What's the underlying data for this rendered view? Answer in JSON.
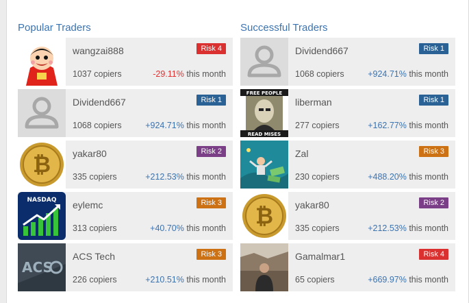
{
  "popular": {
    "title": "Popular Traders",
    "traders": [
      {
        "name": "wangzai888",
        "risk": "Risk 4",
        "copiers": "1037 copiers",
        "gain": "-29.11%",
        "gain_suffix": " this month",
        "avatar": "cartoon-boy-avatar"
      },
      {
        "name": "Dividend667",
        "risk": "Risk 1",
        "copiers": "1068 copiers",
        "gain": "+924.71%",
        "gain_suffix": " this month",
        "avatar": "default-user-avatar"
      },
      {
        "name": "yakar80",
        "risk": "Risk 2",
        "copiers": "335 copiers",
        "gain": "+212.53%",
        "gain_suffix": " this month",
        "avatar": "bitcoin-coin-avatar"
      },
      {
        "name": "eylemc",
        "risk": "Risk 3",
        "copiers": "313 copiers",
        "gain": "+40.70%",
        "gain_suffix": " this month",
        "avatar": "nasdaq-chart-avatar",
        "avatar_text": "NASDAQ"
      },
      {
        "name": "ACS Tech",
        "risk": "Risk 3",
        "copiers": "226 copiers",
        "gain": "+210.51%",
        "gain_suffix": " this month",
        "avatar": "acs-logo-avatar",
        "avatar_text": "ACS"
      }
    ]
  },
  "successful": {
    "title": "Successful Traders",
    "traders": [
      {
        "name": "Dividend667",
        "risk": "Risk 1",
        "copiers": "1068 copiers",
        "gain": "+924.71%",
        "gain_suffix": " this month",
        "avatar": "default-user-avatar"
      },
      {
        "name": "liberman",
        "risk": "Risk 1",
        "copiers": "277 copiers",
        "gain": "+162.77%",
        "gain_suffix": " this month",
        "avatar": "free-people-poster-avatar",
        "avatar_text_top": "FREE PEOPLE",
        "avatar_text_bottom": "READ MISES"
      },
      {
        "name": "Zal",
        "risk": "Risk 3",
        "copiers": "230 copiers",
        "gain": "+488.20%",
        "gain_suffix": " this month",
        "avatar": "money-illustration-avatar"
      },
      {
        "name": "yakar80",
        "risk": "Risk 2",
        "copiers": "335 copiers",
        "gain": "+212.53%",
        "gain_suffix": " this month",
        "avatar": "bitcoin-coin-avatar"
      },
      {
        "name": "Gamalmar1",
        "risk": "Risk 4",
        "copiers": "65 copiers",
        "gain": "+669.97%",
        "gain_suffix": " this month",
        "avatar": "canyon-photo-avatar"
      }
    ]
  }
}
